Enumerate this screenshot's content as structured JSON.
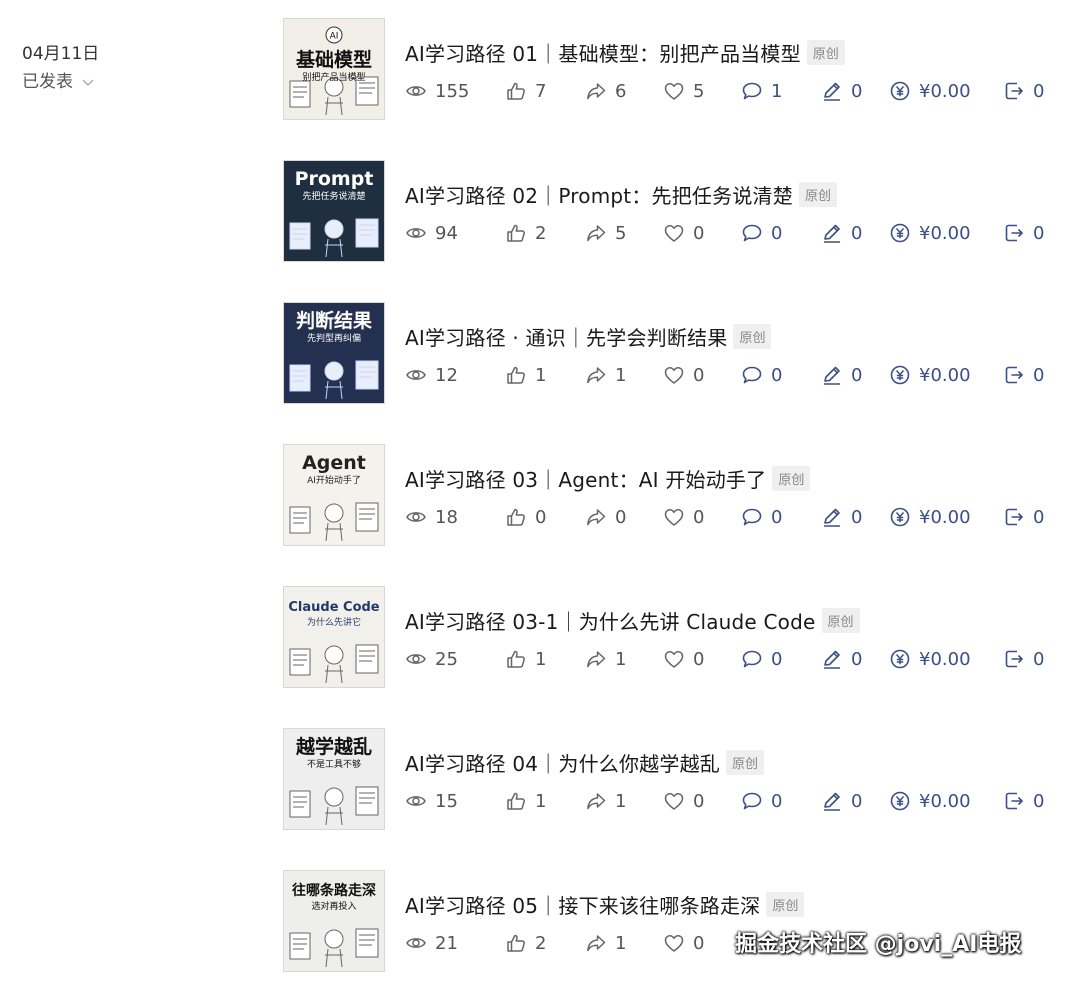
{
  "date_section": {
    "date": "04月11日",
    "status": "已发表",
    "chevron_icon": "chevron-down-icon"
  },
  "badge_label": "原创",
  "stat_icons": [
    "eye-icon",
    "thumbs-up-icon",
    "share-arrow-icon",
    "heart-icon",
    "comment-icon",
    "pen-icon",
    "yuan-coin-icon",
    "export-icon"
  ],
  "articles": [
    {
      "title": "AI学习路径 01｜基础模型：别把产品当模型",
      "thumb": {
        "heading": "基础模型",
        "sub": "别把产品当模型",
        "tag": "AI"
      },
      "stats": [
        "155",
        "7",
        "6",
        "5",
        "1",
        "0",
        "¥0.00",
        "0"
      ]
    },
    {
      "title": "AI学习路径 02｜Prompt：先把任务说清楚",
      "thumb": {
        "heading": "Prompt",
        "sub": "先把任务说清楚",
        "tag": ""
      },
      "stats": [
        "94",
        "2",
        "5",
        "0",
        "0",
        "0",
        "¥0.00",
        "0"
      ]
    },
    {
      "title": "AI学习路径 · 通识｜先学会判断结果",
      "thumb": {
        "heading": "判断结果",
        "sub": "先判型再纠偏",
        "tag": ""
      },
      "stats": [
        "12",
        "1",
        "1",
        "0",
        "0",
        "0",
        "¥0.00",
        "0"
      ]
    },
    {
      "title": "AI学习路径 03｜Agent：AI 开始动手了",
      "thumb": {
        "heading": "Agent",
        "sub": "AI开始动手了",
        "tag": ""
      },
      "stats": [
        "18",
        "0",
        "0",
        "0",
        "0",
        "0",
        "¥0.00",
        "0"
      ]
    },
    {
      "title": "AI学习路径 03-1｜为什么先讲 Claude Code",
      "thumb": {
        "heading": "Claude Code",
        "sub": "为什么先讲它",
        "tag": ""
      },
      "stats": [
        "25",
        "1",
        "1",
        "0",
        "0",
        "0",
        "¥0.00",
        "0"
      ]
    },
    {
      "title": "AI学习路径 04｜为什么你越学越乱",
      "thumb": {
        "heading": "越学越乱",
        "sub": "不是工具不够",
        "tag": ""
      },
      "stats": [
        "15",
        "1",
        "1",
        "0",
        "0",
        "0",
        "¥0.00",
        "0"
      ]
    },
    {
      "title": "AI学习路径 05｜接下来该往哪条路走深",
      "thumb": {
        "heading": "往哪条路走深",
        "sub": "选对再投入",
        "tag": ""
      },
      "stats": [
        "21",
        "2",
        "1",
        "0",
        "",
        "",
        "",
        ""
      ]
    }
  ],
  "watermark": "掘金技术社区 @jovi_AI电报"
}
